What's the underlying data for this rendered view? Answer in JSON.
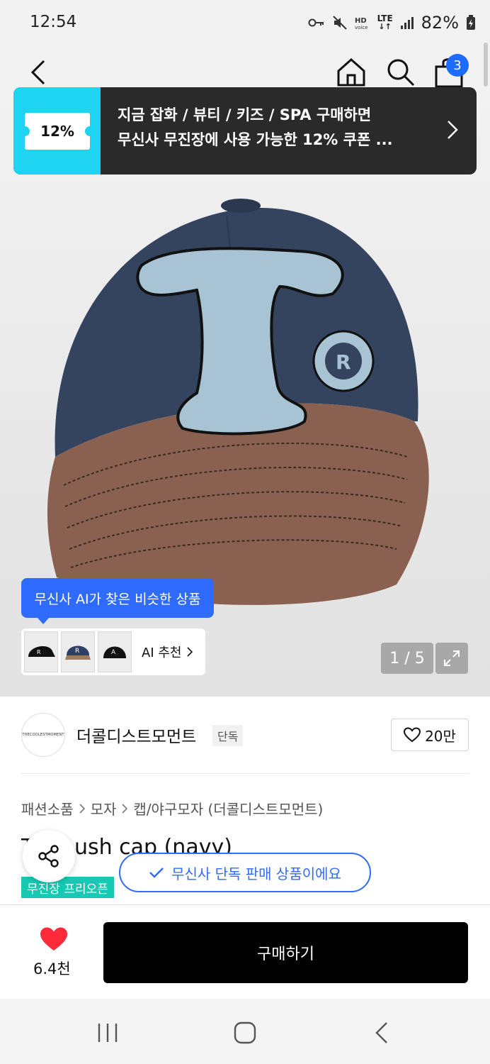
{
  "status_bar": {
    "time": "12:54",
    "network": "LTE",
    "battery": "82%",
    "icons": [
      "key-icon",
      "mute-icon",
      "hd-voice-icon",
      "lte-icon",
      "signal-icon",
      "battery-icon"
    ]
  },
  "header": {
    "icons": [
      "back-icon",
      "home-icon",
      "search-icon",
      "shopping-bag-icon"
    ],
    "cart_count": "3"
  },
  "banner": {
    "ticket_label": "12%",
    "line1": "지금 잡화 / 뷰티 / 키즈 / SPA 구매하면",
    "line2": "무신사 무진장에 사용 가능한 12% 쿠폰 ..."
  },
  "gallery": {
    "ai_tooltip": "무신사 AI가 찾은 비슷한 상품",
    "ai_recommend_label": "AI 추천",
    "page_indicator": "1 / 5",
    "thumbnail_letters": [
      "R",
      "R",
      "A"
    ]
  },
  "brand": {
    "logo_text": "THECOOLESTMOMENT",
    "name": "더콜디스트모먼트",
    "tag": "단독",
    "likes": "20만"
  },
  "breadcrumb": [
    "패션소품",
    "모자",
    "캡/야구모자 (더콜디스트모먼트)"
  ],
  "product": {
    "title": "T     l mush cap (navy)",
    "promo_tag": "무진장 프리오픈"
  },
  "toast": {
    "text": "무신사 단독 판매 상품이에요"
  },
  "bottom_bar": {
    "wish_count": "6.4천",
    "buy_label": "구매하기"
  },
  "colors": {
    "accent_blue": "#2f6bff",
    "banner_cyan": "#1ed4f0",
    "promo_teal": "#17c9b3",
    "heart_red": "#ff2a3a",
    "cap_navy": "#34435e",
    "cap_brim_brown": "#8a6150"
  }
}
